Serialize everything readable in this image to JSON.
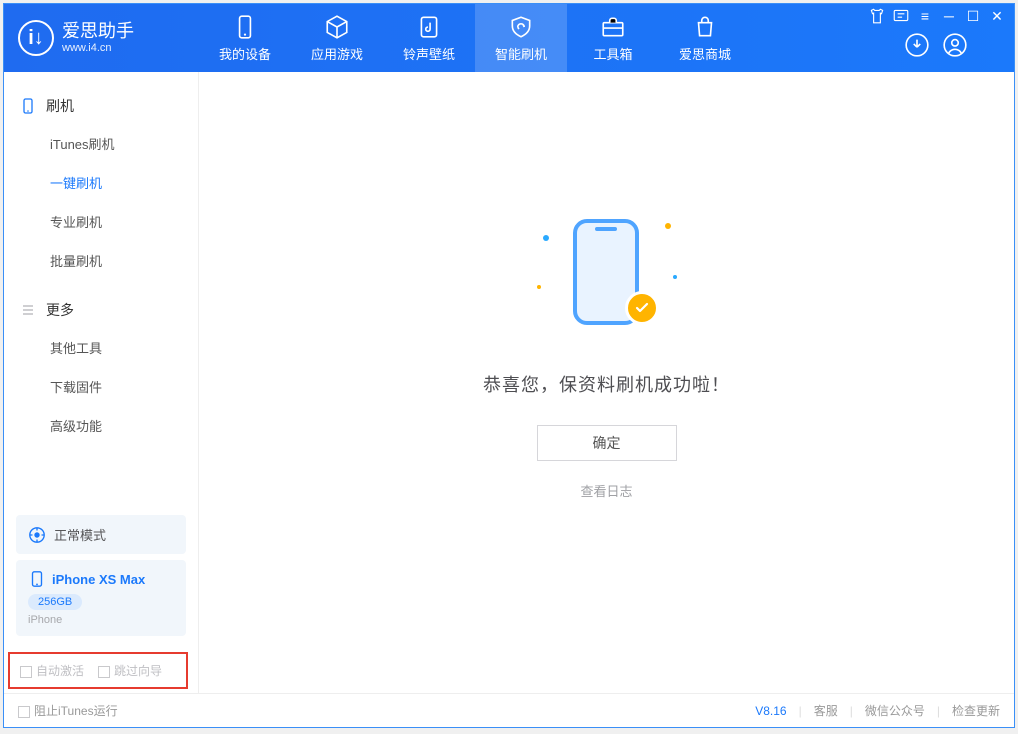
{
  "app": {
    "title": "爱思助手",
    "subtitle": "www.i4.cn"
  },
  "tabs": {
    "device": "我的设备",
    "apps": "应用游戏",
    "ringtones": "铃声壁纸",
    "flash": "智能刷机",
    "toolbox": "工具箱",
    "store": "爱思商城"
  },
  "sidebar": {
    "section_flash": "刷机",
    "items_flash": [
      "iTunes刷机",
      "一键刷机",
      "专业刷机",
      "批量刷机"
    ],
    "section_more": "更多",
    "items_more": [
      "其他工具",
      "下载固件",
      "高级功能"
    ]
  },
  "device": {
    "mode": "正常模式",
    "name": "iPhone XS Max",
    "capacity": "256GB",
    "type": "iPhone"
  },
  "checkboxes": {
    "auto_activate": "自动激活",
    "skip_guide": "跳过向导"
  },
  "main": {
    "success_text": "恭喜您，保资料刷机成功啦！",
    "ok_button": "确定",
    "view_log": "查看日志"
  },
  "statusbar": {
    "prevent_itunes": "阻止iTunes运行",
    "version": "V8.16",
    "support": "客服",
    "wechat": "微信公众号",
    "update": "检查更新"
  }
}
